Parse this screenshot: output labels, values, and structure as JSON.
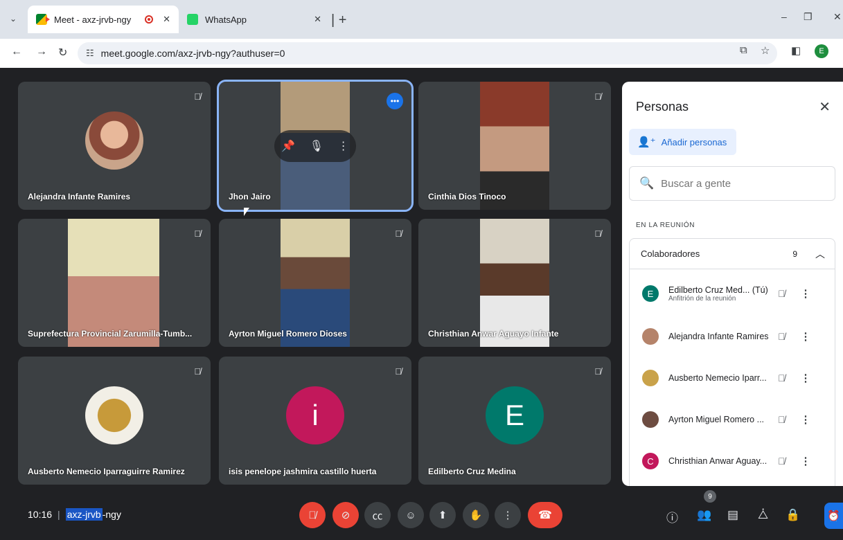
{
  "browser": {
    "tabs": [
      {
        "title": "Meet - axz-jrvb-ngy",
        "active": true
      },
      {
        "title": "WhatsApp",
        "active": false
      }
    ],
    "url": "meet.google.com/axz-jrvb-ngy?authuser=0",
    "profile_initial": "E"
  },
  "tiles": [
    {
      "name": "Alejandra Infante Ramires",
      "kind": "avatar-photo",
      "muted": true
    },
    {
      "name": "Jhon Jairo",
      "kind": "video",
      "muted": false,
      "focused": true
    },
    {
      "name": "Cinthia Dios Tinoco",
      "kind": "video",
      "muted": true
    },
    {
      "name": "Suprefectura Provincial Zarumilla-Tumb...",
      "kind": "video",
      "muted": true
    },
    {
      "name": "Ayrton Miguel Romero Dioses",
      "kind": "video",
      "muted": true
    },
    {
      "name": "Christhian Anwar Aguayo Infante",
      "kind": "video",
      "muted": true
    },
    {
      "name": "Ausberto Nemecio Iparraguirre Ramirez",
      "kind": "avatar-photo",
      "muted": true
    },
    {
      "name": "isis penelope jashmira castillo huerta",
      "kind": "avatar-letter",
      "letter": "i",
      "color": "#c2185b",
      "muted": true
    },
    {
      "name": "Edilberto Cruz Medina",
      "kind": "avatar-letter",
      "letter": "E",
      "color": "#00796b",
      "muted": true
    }
  ],
  "panel": {
    "title": "Personas",
    "add_label": "Añadir personas",
    "search_placeholder": "Buscar a gente",
    "section_label": "EN LA REUNIÓN",
    "group_label": "Colaboradores",
    "group_count": "9",
    "people": [
      {
        "name": "Edilberto Cruz Med...  (Tú)",
        "sub": "Anfitrión de la reunión",
        "initial": "E",
        "color": "#00796b"
      },
      {
        "name": "Alejandra Infante Ramires",
        "sub": "",
        "initial": "",
        "color": "#b5836a"
      },
      {
        "name": "Ausberto Nemecio Iparr...",
        "sub": "",
        "initial": "",
        "color": "#c9a24a"
      },
      {
        "name": "Ayrton Miguel Romero ...",
        "sub": "",
        "initial": "",
        "color": "#6d4c41"
      },
      {
        "name": "Christhian Anwar Aguay...",
        "sub": "",
        "initial": "C",
        "color": "#c2185b"
      }
    ]
  },
  "bottom": {
    "time": "10:16",
    "code_highlight": "axz-jrvb",
    "code_rest": "-ngy",
    "participant_badge": "9"
  }
}
